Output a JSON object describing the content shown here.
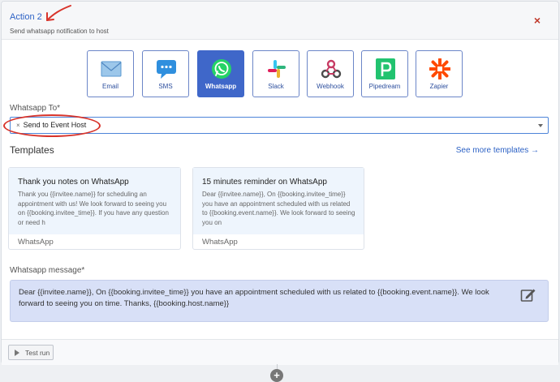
{
  "header": {
    "title": "Action 2",
    "subtitle": "Send whatsapp notification to host",
    "close_label": "×"
  },
  "channels": [
    {
      "label": "Email",
      "icon": "email-icon"
    },
    {
      "label": "SMS",
      "icon": "sms-icon"
    },
    {
      "label": "Whatsapp",
      "icon": "whatsapp-icon",
      "active": true
    },
    {
      "label": "Slack",
      "icon": "slack-icon"
    },
    {
      "label": "Webhook",
      "icon": "webhook-icon"
    },
    {
      "label": "Pipedream",
      "icon": "pipedream-icon"
    },
    {
      "label": "Zapier",
      "icon": "zapier-icon"
    }
  ],
  "whatsapp_to": {
    "label": "Whatsapp To*",
    "tag_remove": "×",
    "selected": "Send to Event Host"
  },
  "templates": {
    "title": "Templates",
    "see_more": "See more templates",
    "see_more_arrow": "→",
    "cards": [
      {
        "title": "Thank you notes on WhatsApp",
        "description": "Thank you {{invitee.name}} for scheduling an appointment with us! We look forward to seeing you on {{booking.invitee_time}}. If you have any question or need h",
        "footer": "WhatsApp"
      },
      {
        "title": "15 minutes reminder on WhatsApp",
        "description": "Dear {{invitee.name}}, On {{booking.invitee_time}} you have an appointment scheduled with us related to {{booking.event.name}}. We look forward to seeing you on",
        "footer": "WhatsApp"
      }
    ]
  },
  "message": {
    "label": "Whatsapp message*",
    "text": "Dear {{invitee.name}}, On {{booking.invitee_time}} you have an appointment scheduled with us related to {{booking.event.name}}. We look forward to seeing you on time. Thanks, {{booking.host.name}}"
  },
  "footer": {
    "test_run": "Test run",
    "add_label": "+"
  },
  "colors": {
    "accent": "#3f67c9",
    "link": "#2d62c5",
    "close": "#c0392b",
    "annotation": "#d8342b",
    "message_bg": "#d8e0f7"
  }
}
